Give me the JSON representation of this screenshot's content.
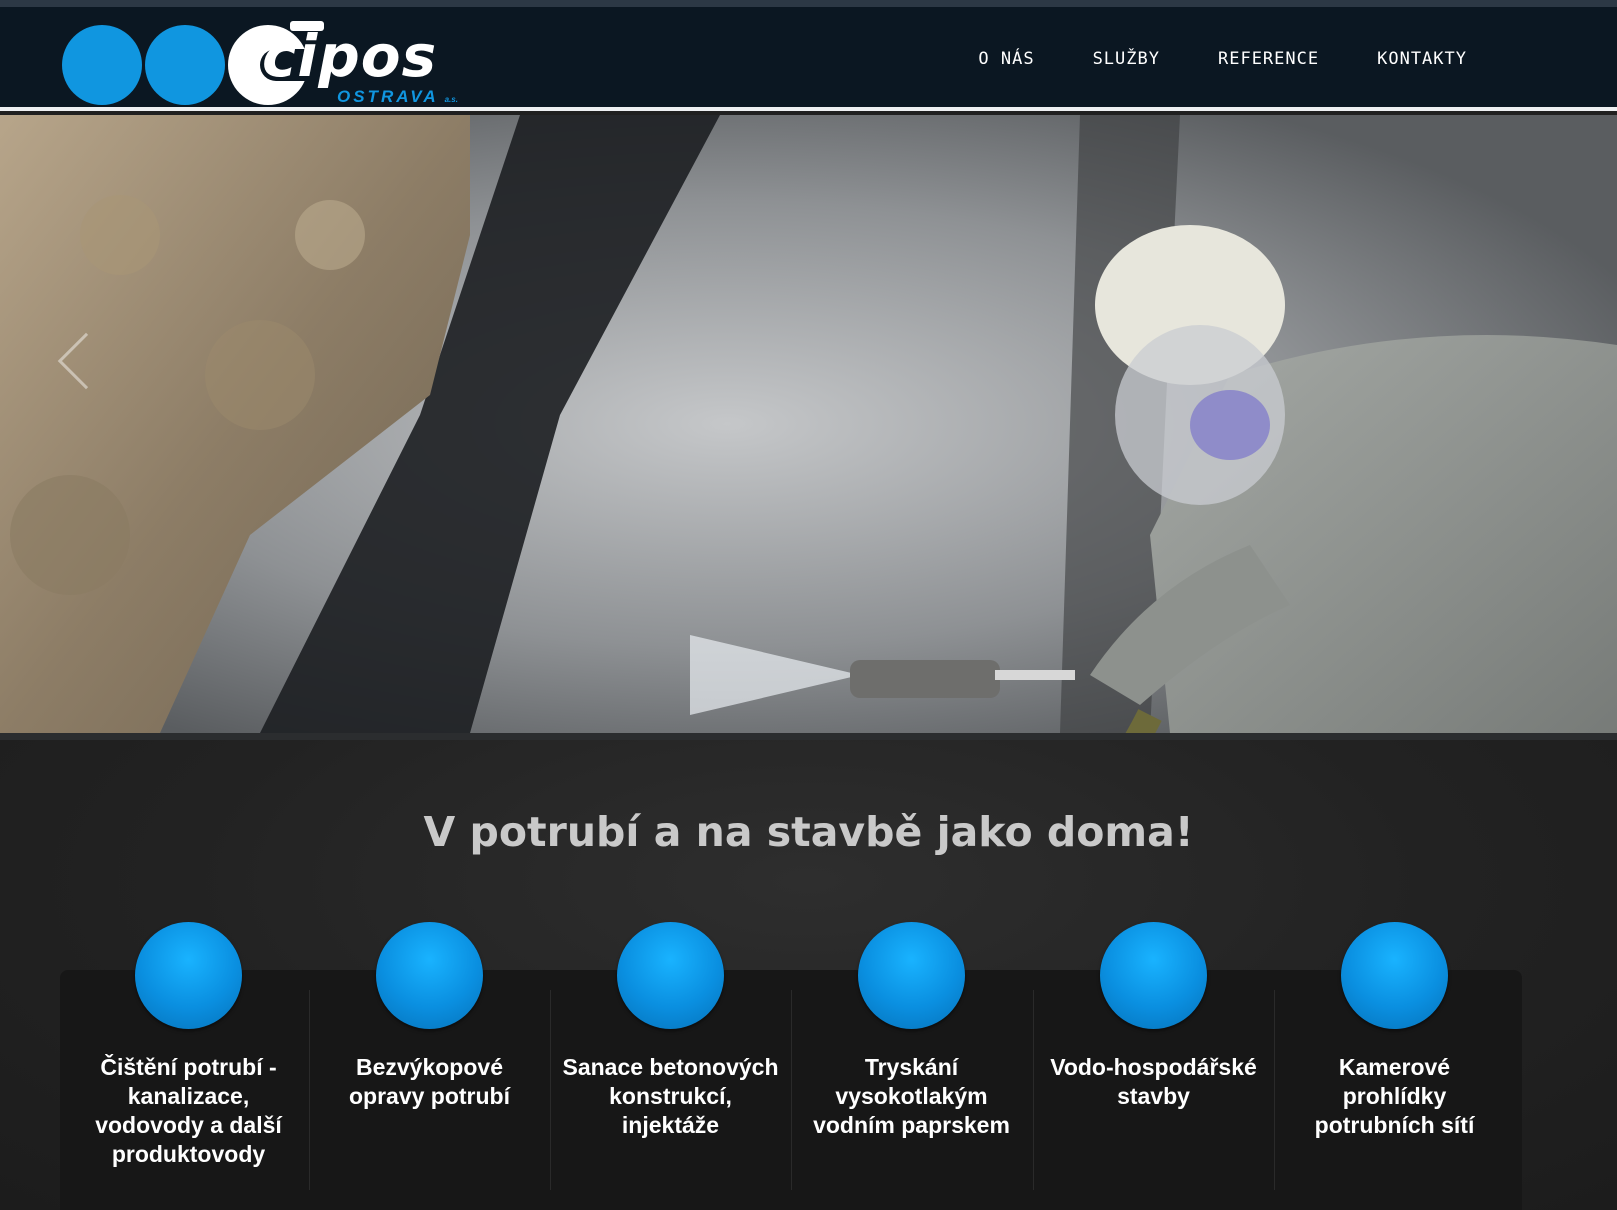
{
  "brand": {
    "name": "cipos",
    "subtitle": "OSTRAVA",
    "suffix": "a.s.",
    "color": "#1096e0"
  },
  "nav": {
    "items": [
      {
        "label": "O NÁS"
      },
      {
        "label": "SLUŽBY"
      },
      {
        "label": "REFERENCE"
      },
      {
        "label": "KONTAKTY"
      }
    ]
  },
  "hero": {
    "description_icon": "slider-prev-arrow-icon"
  },
  "main": {
    "tagline": "V potrubí a na stavbě jako doma!",
    "services": [
      {
        "title": "Čištění potrubí - kanalizace, vodovody a další produktovody",
        "icon": "circle-icon"
      },
      {
        "title": "Bezvýkopové opravy potrubí",
        "icon": "circle-icon"
      },
      {
        "title": "Sanace betonových konstrukcí, injektáže",
        "icon": "circle-icon"
      },
      {
        "title": "Tryskání vysokotlakým vodním paprskem",
        "icon": "circle-icon"
      },
      {
        "title": "Vodo-hospodářské stavby",
        "icon": "circle-icon"
      },
      {
        "title": "Kamerové prohlídky potrubních sítí",
        "icon": "circle-icon"
      }
    ]
  },
  "colors": {
    "navbar": "#0b1722",
    "accent": "#1096e0",
    "section_bg": "#222222"
  }
}
